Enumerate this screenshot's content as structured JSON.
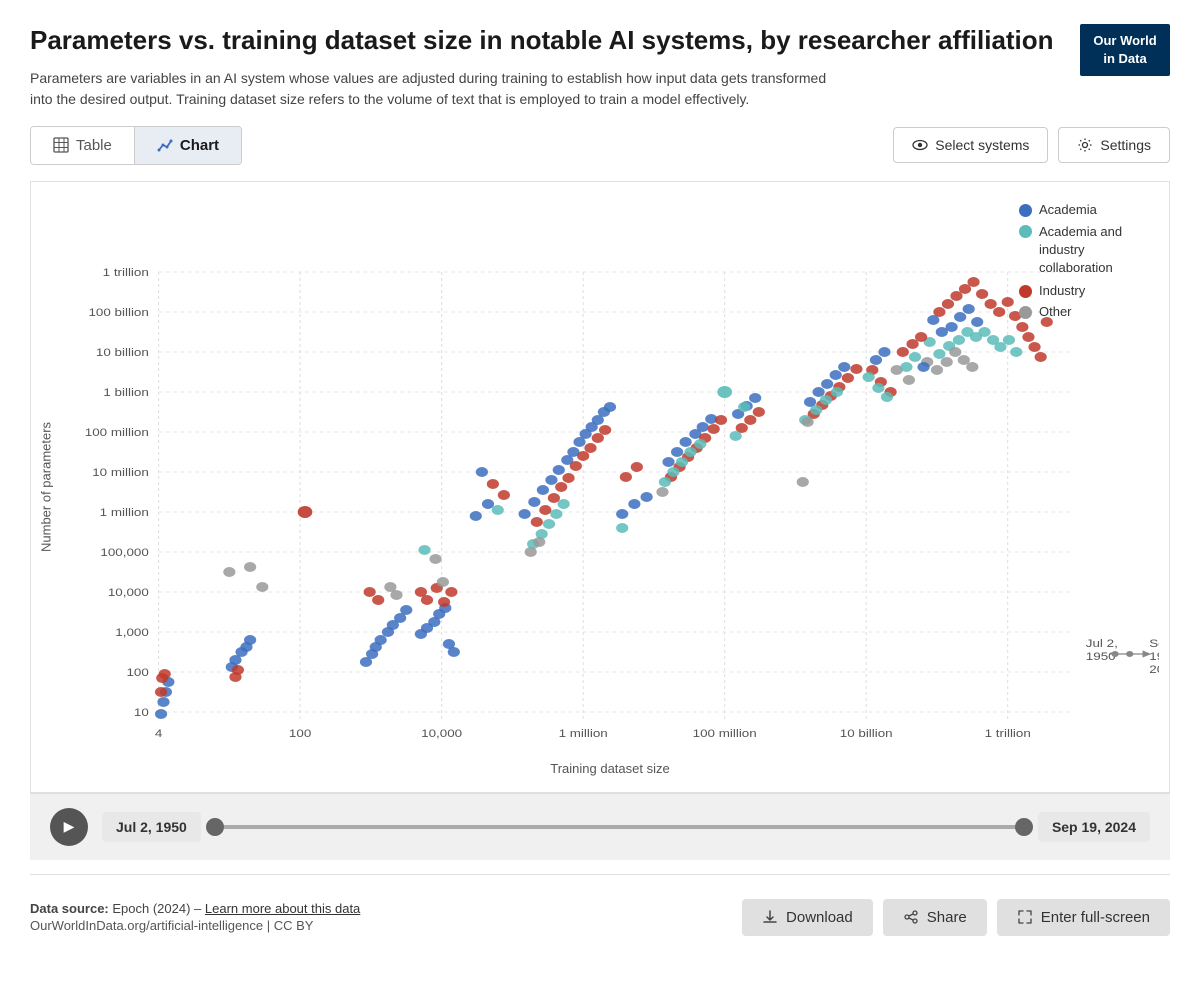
{
  "header": {
    "title": "Parameters vs. training dataset size in notable AI systems, by researcher affiliation",
    "subtitle": "Parameters are variables in an AI system whose values are adjusted during training to establish how input data gets transformed into the desired output. Training dataset size refers to the volume of text that is employed to train a model effectively.",
    "logo_line1": "Our World",
    "logo_line2": "in Data"
  },
  "tabs": {
    "table_label": "Table",
    "chart_label": "Chart",
    "active": "Chart"
  },
  "toolbar": {
    "select_systems_label": "Select systems",
    "settings_label": "Settings"
  },
  "legend": {
    "items": [
      {
        "label": "Academia",
        "color": "#3c6ebf"
      },
      {
        "label": "Academia and industry collaboration",
        "color": "#5bbcb8"
      },
      {
        "label": "Industry",
        "color": "#c0392b"
      },
      {
        "label": "Other",
        "color": "#999999"
      }
    ]
  },
  "chart": {
    "y_label": "Number of parameters",
    "x_label": "Training dataset size",
    "y_ticks": [
      "1 trillion",
      "100 billion",
      "10 billion",
      "1 billion",
      "100 million",
      "10 million",
      "1 million",
      "100,000",
      "10,000",
      "1,000",
      "100",
      "10"
    ],
    "x_ticks": [
      "4",
      "100",
      "10,000",
      "1 million",
      "100 million",
      "10 billion",
      "1 trillion"
    ],
    "time_start": "Jul 2, 1950",
    "time_end": "Sep 19, 2024"
  },
  "playback": {
    "play_label": "▶",
    "start_date": "Jul 2, 1950",
    "end_date": "Sep 19, 2024"
  },
  "footer": {
    "data_source_label": "Data source:",
    "data_source_text": "Epoch (2024) –",
    "learn_more_label": "Learn more about this data",
    "url": "OurWorldInData.org/artificial-intelligence | CC BY",
    "download_label": "Download",
    "share_label": "Share",
    "fullscreen_label": "Enter full-screen"
  }
}
